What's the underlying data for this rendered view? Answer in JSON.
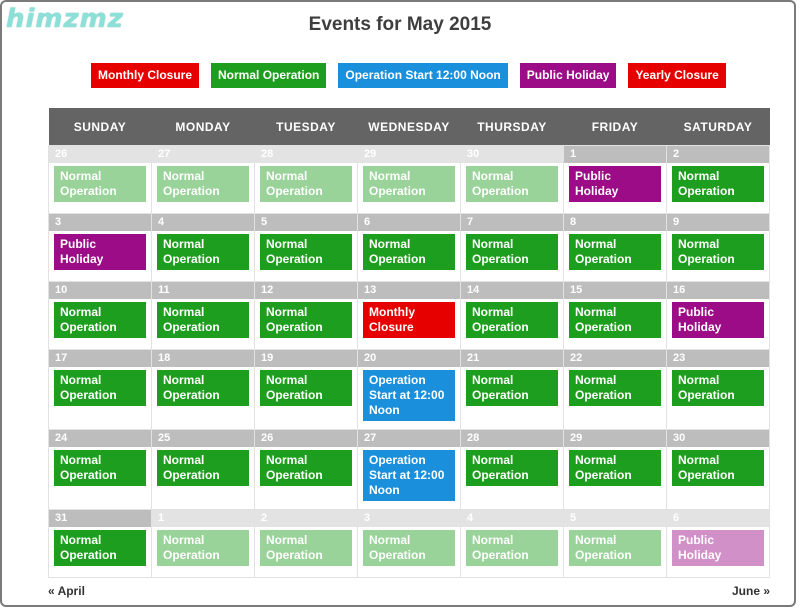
{
  "watermark": "himzmz",
  "title": "Events for May 2015",
  "legend": [
    {
      "label": "Monthly Closure",
      "color": "#e60000"
    },
    {
      "label": "Normal Operation",
      "color": "#1e9e1e"
    },
    {
      "label": "Operation Start 12:00 Noon",
      "color": "#1a8fdb"
    },
    {
      "label": "Public Holiday",
      "color": "#9b0c86"
    },
    {
      "label": "Yearly Closure",
      "color": "#e60000"
    }
  ],
  "colors": {
    "Normal Operation": "#1e9e1e",
    "Public Holiday": "#9b0c86",
    "Monthly Closure": "#e60000",
    "Operation Start at 12:00 Noon": "#1a8fdb"
  },
  "weekdays": [
    "SUNDAY",
    "MONDAY",
    "TUESDAY",
    "WEDNESDAY",
    "THURSDAY",
    "FRIDAY",
    "SATURDAY"
  ],
  "weeks": [
    [
      {
        "day": "26",
        "other": true,
        "event": "Normal Operation"
      },
      {
        "day": "27",
        "other": true,
        "event": "Normal Operation"
      },
      {
        "day": "28",
        "other": true,
        "event": "Normal Operation"
      },
      {
        "day": "29",
        "other": true,
        "event": "Normal Operation"
      },
      {
        "day": "30",
        "other": true,
        "event": "Normal Operation"
      },
      {
        "day": "1",
        "other": false,
        "event": "Public Holiday"
      },
      {
        "day": "2",
        "other": false,
        "event": "Normal Operation"
      }
    ],
    [
      {
        "day": "3",
        "other": false,
        "event": "Public Holiday"
      },
      {
        "day": "4",
        "other": false,
        "event": "Normal Operation"
      },
      {
        "day": "5",
        "other": false,
        "event": "Normal Operation"
      },
      {
        "day": "6",
        "other": false,
        "event": "Normal Operation"
      },
      {
        "day": "7",
        "other": false,
        "event": "Normal Operation"
      },
      {
        "day": "8",
        "other": false,
        "event": "Normal Operation"
      },
      {
        "day": "9",
        "other": false,
        "event": "Normal Operation"
      }
    ],
    [
      {
        "day": "10",
        "other": false,
        "event": "Normal Operation"
      },
      {
        "day": "11",
        "other": false,
        "event": "Normal Operation"
      },
      {
        "day": "12",
        "other": false,
        "event": "Normal Operation"
      },
      {
        "day": "13",
        "other": false,
        "event": "Monthly Closure"
      },
      {
        "day": "14",
        "other": false,
        "event": "Normal Operation"
      },
      {
        "day": "15",
        "other": false,
        "event": "Normal Operation"
      },
      {
        "day": "16",
        "other": false,
        "event": "Public Holiday"
      }
    ],
    [
      {
        "day": "17",
        "other": false,
        "event": "Normal Operation"
      },
      {
        "day": "18",
        "other": false,
        "event": "Normal Operation"
      },
      {
        "day": "19",
        "other": false,
        "event": "Normal Operation"
      },
      {
        "day": "20",
        "other": false,
        "event": "Operation Start at 12:00 Noon"
      },
      {
        "day": "21",
        "other": false,
        "event": "Normal Operation"
      },
      {
        "day": "22",
        "other": false,
        "event": "Normal Operation"
      },
      {
        "day": "23",
        "other": false,
        "event": "Normal Operation"
      }
    ],
    [
      {
        "day": "24",
        "other": false,
        "event": "Normal Operation"
      },
      {
        "day": "25",
        "other": false,
        "event": "Normal Operation"
      },
      {
        "day": "26",
        "other": false,
        "event": "Normal Operation"
      },
      {
        "day": "27",
        "other": false,
        "event": "Operation Start at 12:00 Noon"
      },
      {
        "day": "28",
        "other": false,
        "event": "Normal Operation"
      },
      {
        "day": "29",
        "other": false,
        "event": "Normal Operation"
      },
      {
        "day": "30",
        "other": false,
        "event": "Normal Operation"
      }
    ],
    [
      {
        "day": "31",
        "other": false,
        "event": "Normal Operation"
      },
      {
        "day": "1",
        "other": true,
        "event": "Normal Operation"
      },
      {
        "day": "2",
        "other": true,
        "event": "Normal Operation"
      },
      {
        "day": "3",
        "other": true,
        "event": "Normal Operation"
      },
      {
        "day": "4",
        "other": true,
        "event": "Normal Operation"
      },
      {
        "day": "5",
        "other": true,
        "event": "Normal Operation"
      },
      {
        "day": "6",
        "other": true,
        "event": "Public Holiday"
      }
    ]
  ],
  "nav": {
    "prev": "« April",
    "next": "June »"
  }
}
